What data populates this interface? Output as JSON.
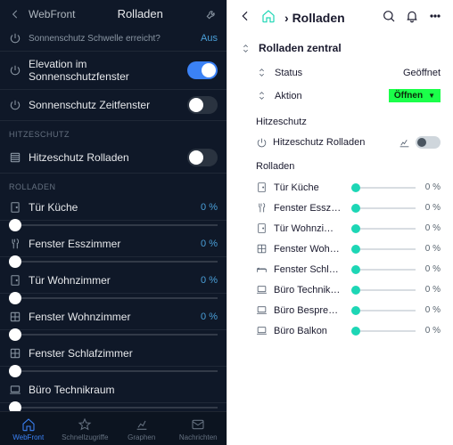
{
  "left": {
    "header": {
      "app": "WebFront",
      "title": "Rolladen"
    },
    "sonnenschutz": {
      "schwelle": {
        "label": "Sonnenschutz Schwelle erreicht?",
        "value": "Aus"
      },
      "elevation": {
        "label": "Elevation im Sonnenschutzfenster",
        "on": true
      },
      "zeitfenster": {
        "label": "Sonnenschutz Zeitfenster",
        "on": false
      }
    },
    "hitze": {
      "section": "HITZESCHUTZ",
      "label": "Hitzeschutz Rolladen",
      "on": false
    },
    "roll": {
      "section": "ROLLADEN",
      "items": [
        {
          "label": "Tür Küche",
          "value": "0 %"
        },
        {
          "label": "Fenster Esszimmer",
          "value": "0 %"
        },
        {
          "label": "Tür Wohnzimmer",
          "value": "0 %"
        },
        {
          "label": "Fenster Wohnzimmer",
          "value": "0 %"
        },
        {
          "label": "Fenster Schlafzimmer",
          "value": ""
        },
        {
          "label": "Büro Technikraum",
          "value": ""
        }
      ]
    },
    "nav": [
      {
        "label": "WebFront"
      },
      {
        "label": "Schnellzugriffe"
      },
      {
        "label": "Graphen"
      },
      {
        "label": "Nachrichten"
      }
    ]
  },
  "right": {
    "header": {
      "title": "Rolladen"
    },
    "group": {
      "title": "Rolladen zentral"
    },
    "status": {
      "label": "Status",
      "value": "Geöffnet"
    },
    "action": {
      "label": "Aktion",
      "value": "Öffnen"
    },
    "hitze": {
      "section": "Hitzeschutz",
      "label": "Hitzeschutz Rolladen"
    },
    "roll": {
      "section": "Rolladen",
      "items": [
        {
          "label": "Tür Küche",
          "value": "0 %"
        },
        {
          "label": "Fenster Esszi…",
          "value": "0 %"
        },
        {
          "label": "Tür Wohnzim…",
          "value": "0 %"
        },
        {
          "label": "Fenster Wohn…",
          "value": "0 %"
        },
        {
          "label": "Fenster Schlaf…",
          "value": "0 %"
        },
        {
          "label": "Büro Technikr…",
          "value": "0 %"
        },
        {
          "label": "Büro Besprec…",
          "value": "0 %"
        },
        {
          "label": "Büro Balkon",
          "value": "0 %"
        }
      ]
    }
  }
}
